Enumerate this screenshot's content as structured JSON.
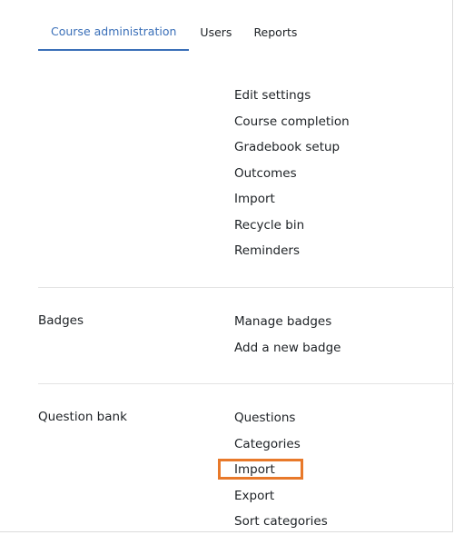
{
  "tabs": [
    {
      "label": "Course administration",
      "active": true
    },
    {
      "label": "Users",
      "active": false
    },
    {
      "label": "Reports",
      "active": false
    }
  ],
  "sections": {
    "course": {
      "title": "",
      "links": [
        "Edit settings",
        "Course completion",
        "Gradebook setup",
        "Outcomes",
        "Import",
        "Recycle bin",
        "Reminders"
      ]
    },
    "badges": {
      "title": "Badges",
      "links": [
        "Manage badges",
        "Add a new badge"
      ]
    },
    "question_bank": {
      "title": "Question bank",
      "links": [
        "Questions",
        "Categories",
        "Import",
        "Export",
        "Sort categories"
      ]
    }
  },
  "colors": {
    "accent": "#3a6fb8",
    "highlight": "#e8792a"
  }
}
